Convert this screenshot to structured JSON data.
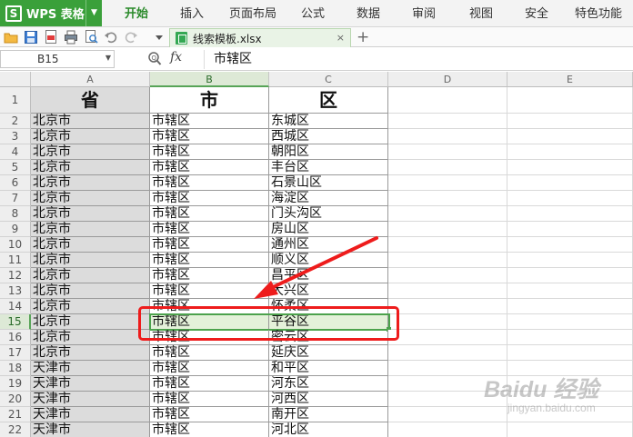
{
  "app": {
    "name": "WPS 表格",
    "logo_letter": "S",
    "menu_items": [
      "开始",
      "插入",
      "页面布局",
      "公式",
      "数据",
      "审阅",
      "视图",
      "安全",
      "特色功能"
    ],
    "active_menu": "开始",
    "accent_color": "#3aa03a"
  },
  "toolbar": {
    "icons": [
      "open-folder-icon",
      "save-icon",
      "export-pdf-icon",
      "print-icon",
      "print-preview-icon",
      "undo-icon",
      "redo-icon",
      "dropdown-icon"
    ],
    "document_tab": "线索模板.xlsx",
    "close_glyph": "×",
    "new_tab_glyph": "+"
  },
  "formula_bar": {
    "cell_ref": "B15",
    "fx_label": "fx",
    "value": "市辖区"
  },
  "sheet": {
    "columns": [
      "A",
      "B",
      "C",
      "D",
      "E"
    ],
    "selected_column": "B",
    "header_row": [
      "省",
      "市",
      "区"
    ],
    "selected_row": 15,
    "rows": [
      {
        "num": "2",
        "cells": [
          "北京市",
          "市辖区",
          "东城区"
        ]
      },
      {
        "num": "3",
        "cells": [
          "北京市",
          "市辖区",
          "西城区"
        ]
      },
      {
        "num": "4",
        "cells": [
          "北京市",
          "市辖区",
          "朝阳区"
        ]
      },
      {
        "num": "5",
        "cells": [
          "北京市",
          "市辖区",
          "丰台区"
        ]
      },
      {
        "num": "6",
        "cells": [
          "北京市",
          "市辖区",
          "石景山区"
        ]
      },
      {
        "num": "7",
        "cells": [
          "北京市",
          "市辖区",
          "海淀区"
        ]
      },
      {
        "num": "8",
        "cells": [
          "北京市",
          "市辖区",
          "门头沟区"
        ]
      },
      {
        "num": "9",
        "cells": [
          "北京市",
          "市辖区",
          "房山区"
        ]
      },
      {
        "num": "10",
        "cells": [
          "北京市",
          "市辖区",
          "通州区"
        ]
      },
      {
        "num": "11",
        "cells": [
          "北京市",
          "市辖区",
          "顺义区"
        ]
      },
      {
        "num": "12",
        "cells": [
          "北京市",
          "市辖区",
          "昌平区"
        ]
      },
      {
        "num": "13",
        "cells": [
          "北京市",
          "市辖区",
          "大兴区"
        ]
      },
      {
        "num": "14",
        "cells": [
          "北京市",
          "市辖区",
          "怀柔区"
        ]
      },
      {
        "num": "15",
        "cells": [
          "北京市",
          "市辖区",
          "平谷区"
        ]
      },
      {
        "num": "16",
        "cells": [
          "北京市",
          "市辖区",
          "密云区"
        ]
      },
      {
        "num": "17",
        "cells": [
          "北京市",
          "市辖区",
          "延庆区"
        ]
      },
      {
        "num": "18",
        "cells": [
          "天津市",
          "市辖区",
          "和平区"
        ]
      },
      {
        "num": "19",
        "cells": [
          "天津市",
          "市辖区",
          "河东区"
        ]
      },
      {
        "num": "20",
        "cells": [
          "天津市",
          "市辖区",
          "河西区"
        ]
      },
      {
        "num": "21",
        "cells": [
          "天津市",
          "市辖区",
          "南开区"
        ]
      },
      {
        "num": "22",
        "cells": [
          "天津市",
          "市辖区",
          "河北区"
        ]
      }
    ]
  },
  "annotation": {
    "highlight_color": "#ee1c1c"
  },
  "watermark": {
    "main": "Baidu 经验",
    "sub": "jingyan.baidu.com"
  }
}
